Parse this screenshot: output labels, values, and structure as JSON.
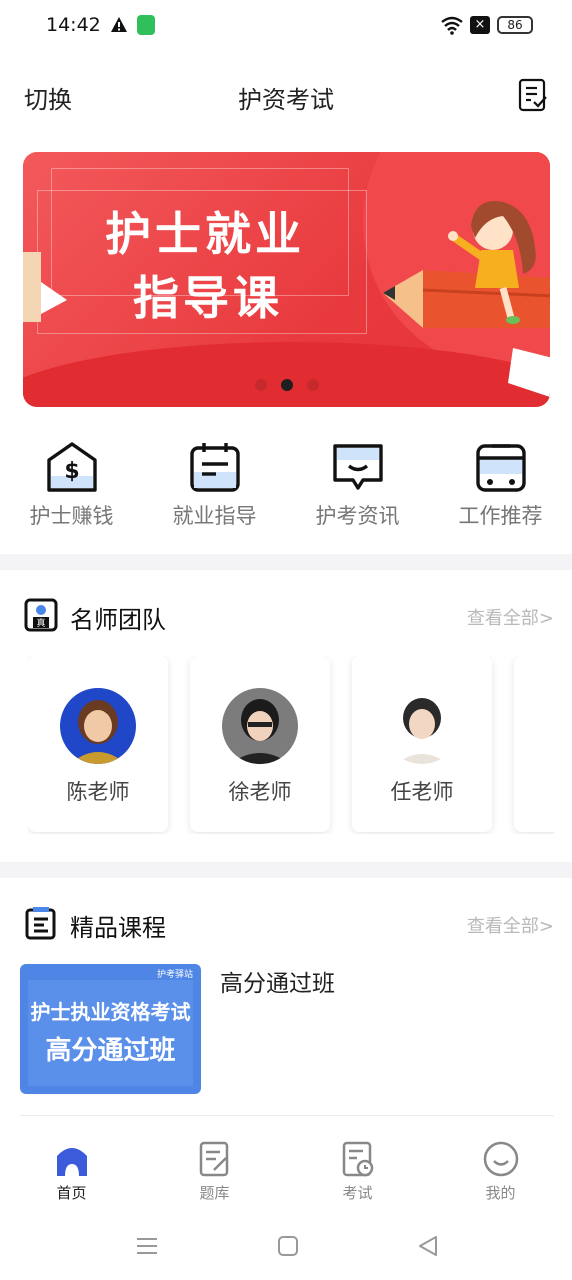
{
  "status_bar": {
    "time": "14:42",
    "battery": "86",
    "sim_badge": "×"
  },
  "header": {
    "switch_label": "切换",
    "title": "护资考试"
  },
  "banner": {
    "line1": "护士就业",
    "line2": "指导课",
    "dots": 3,
    "active_dot": 1,
    "colors": {
      "primary": "#e83a3e",
      "dark": "#c62a2d"
    }
  },
  "quick_menu": [
    {
      "label": "护士赚钱",
      "icon": "money-house-icon"
    },
    {
      "label": "就业指导",
      "icon": "calendar-note-icon"
    },
    {
      "label": "护考资讯",
      "icon": "message-icon"
    },
    {
      "label": "工作推荐",
      "icon": "bus-icon"
    }
  ],
  "teachers_section": {
    "title": "名师团队",
    "more": "查看全部>",
    "teachers": [
      {
        "name": "陈老师"
      },
      {
        "name": "徐老师"
      },
      {
        "name": "任老师"
      }
    ]
  },
  "courses_section": {
    "title": "精品课程",
    "more": "查看全部>",
    "course": {
      "title": "高分通过班",
      "thumb_logo": "护考驿站",
      "thumb_line1": "护士执业资格考试",
      "thumb_line2": "高分通过班"
    }
  },
  "bottom_nav": [
    {
      "label": "首页",
      "icon": "home-icon",
      "active": true
    },
    {
      "label": "题库",
      "icon": "question-bank-icon",
      "active": false
    },
    {
      "label": "考试",
      "icon": "exam-icon",
      "active": false
    },
    {
      "label": "我的",
      "icon": "profile-icon",
      "active": false
    }
  ],
  "accent_color": "#3b5bdb"
}
